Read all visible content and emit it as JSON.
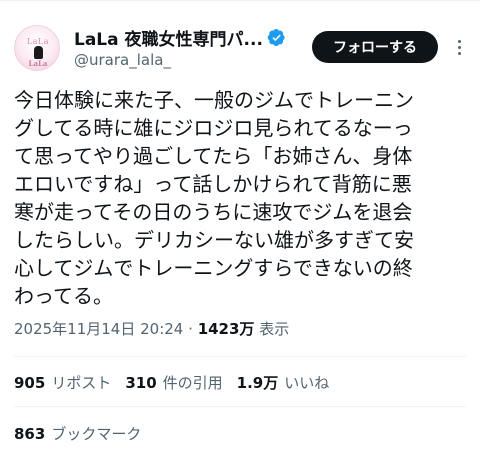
{
  "author": {
    "display_name": "LaLa 夜職女性専門パ...",
    "handle": "@urara_lala_",
    "avatar_text_top": "LaLa",
    "avatar_text_bottom": "LaLa",
    "verified": true
  },
  "actions": {
    "follow_label": "フォローする",
    "more_icon": "more-dots-icon"
  },
  "tweet": {
    "lines": [
      "今日体験に来た子、一般のジムでトレーニン",
      "グしてる時に雄にジロジロ見られてるなーっ",
      "て思ってやり過ごしてたら「お姉さん、身体",
      "エロいですね」って話しかけられて背筋に悪",
      "寒が走ってその日のうちに速攻でジムを退会",
      "したらしい。デリカシーない雄が多すぎて安",
      "心してジムでトレーニングすらできないの終",
      "わってる。"
    ]
  },
  "meta": {
    "timestamp": "2025年11月14日 20:24",
    "separator": "·",
    "views_count": "1423万",
    "views_label": "表示"
  },
  "stats": {
    "reposts_count": "905",
    "reposts_label": "リポスト",
    "quotes_count": "310",
    "quotes_label": "件の引用",
    "likes_count": "1.9万",
    "likes_label": "いいね",
    "bookmarks_count": "863",
    "bookmarks_label": "ブックマーク"
  },
  "colors": {
    "verified": "#1d9bf0",
    "text_primary": "#0f1419",
    "text_secondary": "#536471",
    "button_bg": "#0f1419",
    "divider": "#eff3f4"
  }
}
